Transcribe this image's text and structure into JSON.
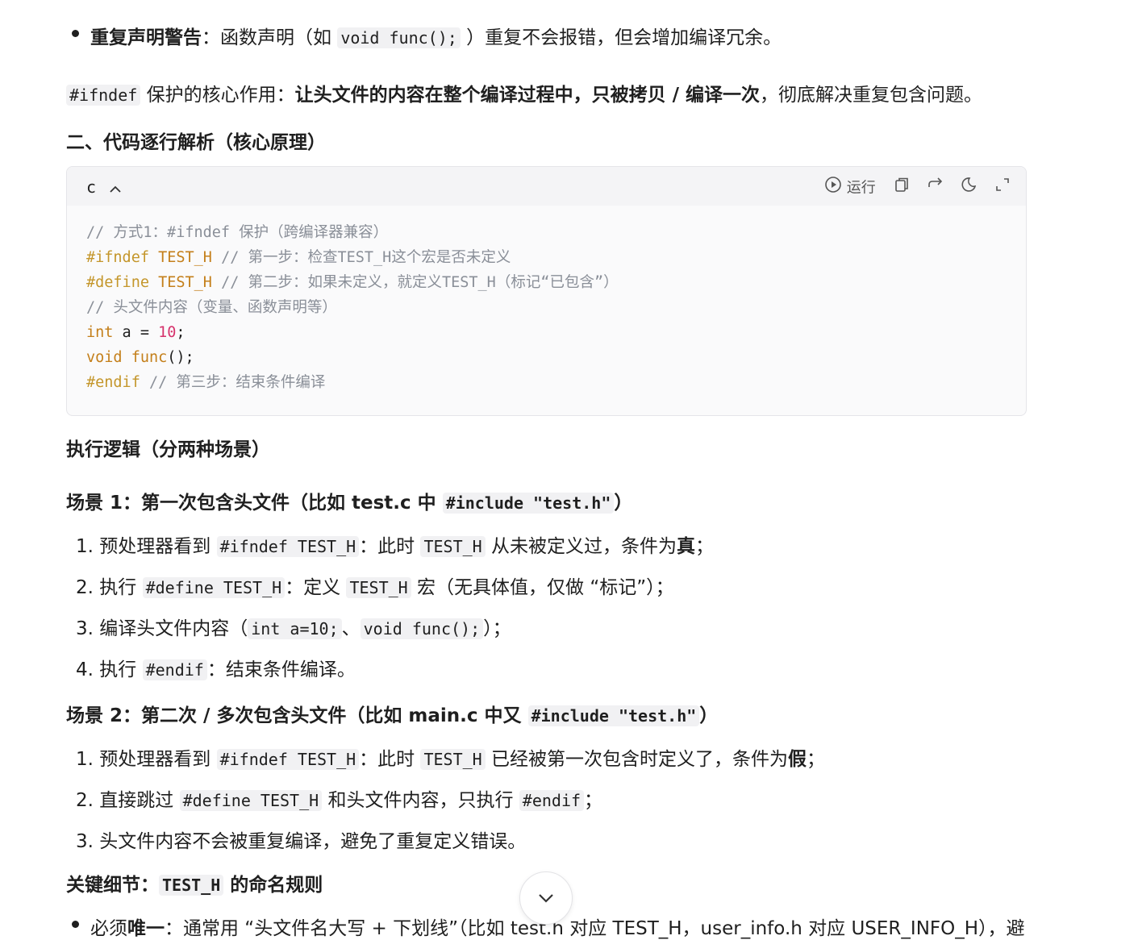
{
  "bullet1": {
    "bold": "重复声明警告",
    "text1": "：函数声明（如 ",
    "code": "void func();",
    "text2": " ）重复不会报错，但会增加编译冗余。"
  },
  "summary": {
    "code": "#ifndef",
    "text1": " 保护的核心作用：",
    "bold": "让头文件的内容在整个编译过程中，只被拷贝 / 编译一次",
    "text2": "，彻底解决重复包含问题。"
  },
  "section2_title": "二、代码逐行解析（核心原理）",
  "code_block": {
    "language": "c",
    "run_label": "运行",
    "lines": {
      "l1": "// 方式1：#ifndef 保护（跨编译器兼容）",
      "l2_dir": "#ifndef",
      "l2_mac": "TEST_H",
      "l2_cm": "// 第一步：检查TEST_H这个宏是否未定义",
      "l3_dir": "#define",
      "l3_mac": "TEST_H",
      "l3_cm": "// 第二步：如果未定义，就定义TEST_H（标记“已包含”）",
      "l4": "// 头文件内容（变量、函数声明等）",
      "l5_kw": "int",
      "l5_mid": " a = ",
      "l5_num": "10",
      "l5_end": ";",
      "l6_kw": "void",
      "l6_fn": "func",
      "l6_end": "();",
      "l7_dir": "#endif",
      "l7_cm": "// 第三步：结束条件编译"
    }
  },
  "exec_title": "执行逻辑（分两种场景）",
  "scene1": {
    "title_a": "场景 1：第一次包含头文件（比如 test.c 中 ",
    "title_code": "#include \"test.h\"",
    "title_b": "）",
    "items": [
      {
        "num": "1.",
        "t1": " 预处理器看到 ",
        "c1": "#ifndef TEST_H",
        "t2": "：此时 ",
        "c2": "TEST_H",
        "t3": " 从未被定义过，条件为",
        "b": "真",
        "t4": "；"
      },
      {
        "num": "2.",
        "t1": " 执行 ",
        "c1": "#define TEST_H",
        "t2": "：定义 ",
        "c2": "TEST_H",
        "t3": " 宏（无具体值，仅做 “标记”）；"
      },
      {
        "num": "3.",
        "t1": " 编译头文件内容（",
        "c1": "int a=10;",
        "t2": "、",
        "c2": "void func();",
        "t3": "）；"
      },
      {
        "num": "4.",
        "t1": " 执行 ",
        "c1": "#endif",
        "t2": "：结束条件编译。"
      }
    ]
  },
  "scene2": {
    "title_a": "场景 2：第二次 / 多次包含头文件（比如 main.c 中又 ",
    "title_code": "#include \"test.h\"",
    "title_b": "）",
    "items": [
      {
        "num": "1.",
        "t1": " 预处理器看到 ",
        "c1": "#ifndef TEST_H",
        "t2": "：此时 ",
        "c2": "TEST_H",
        "t3": " 已经被第一次包含时定义了，条件为",
        "b": "假",
        "t4": "；"
      },
      {
        "num": "2.",
        "t1": " 直接跳过 ",
        "c1": "#define TEST_H",
        "t2": " 和头文件内容，只执行 ",
        "c2": "#endif",
        "t3": "；"
      },
      {
        "num": "3.",
        "t1": " 头文件内容不会被重复编译，避免了重复定义错误。"
      }
    ]
  },
  "key_detail": {
    "t1": "关键细节：",
    "code": "TEST_H",
    "t2": " 的命名规则"
  },
  "last_bullet": {
    "t1": "必须",
    "bold": "唯一",
    "t2": "：通常用 “头文件名大写 + 下划线”（比如 test.h 对应 TEST_H，user_info.h 对应 USER_INFO_H），避"
  },
  "icons": {
    "chevron_up": "chevron-up-icon",
    "run": "play-circle-icon",
    "copy": "copy-icon",
    "wrap": "wrap-icon",
    "theme": "moon-icon",
    "expand": "expand-icon",
    "scroll_down": "chevron-down-icon"
  }
}
